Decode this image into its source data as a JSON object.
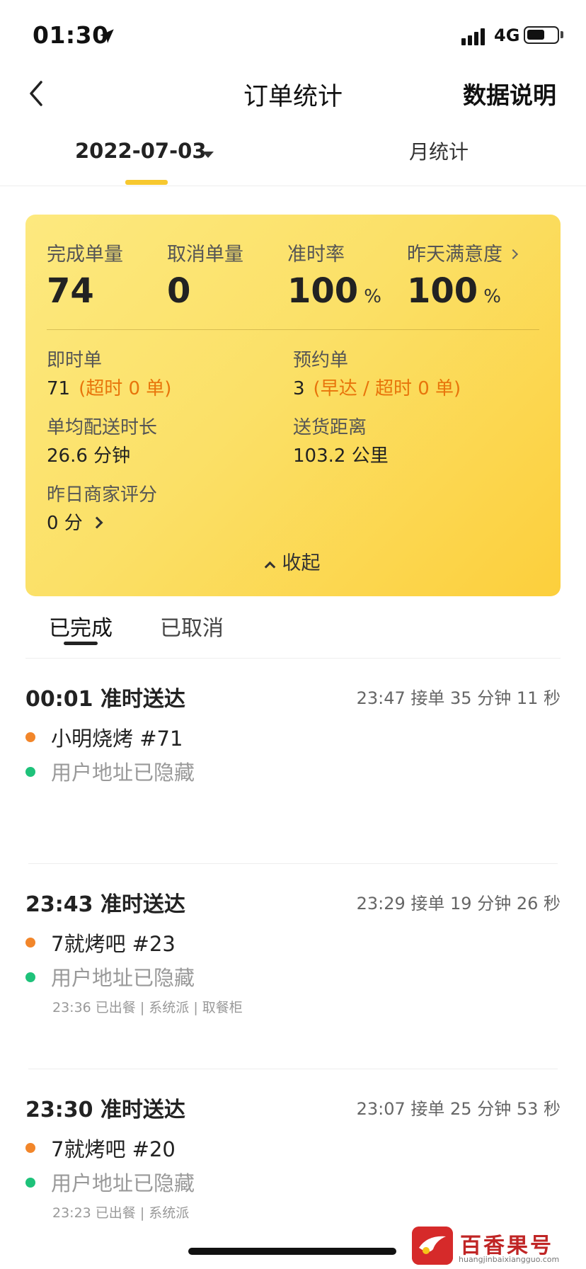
{
  "status_bar": {
    "time": "01:30",
    "network": "4G",
    "battery_level": 0.6
  },
  "nav": {
    "title": "订单统计",
    "right_action": "数据说明"
  },
  "date_tabs": {
    "date": "2022-07-03",
    "month_tab": "月统计"
  },
  "stats": {
    "completed_label": "完成单量",
    "completed_value": "74",
    "cancelled_label": "取消单量",
    "cancelled_value": "0",
    "ontime_label": "准时率",
    "ontime_value": "100",
    "ontime_unit": "%",
    "satisfaction_label": "昨天满意度",
    "satisfaction_value": "100",
    "satisfaction_unit": "%"
  },
  "details": {
    "instant_label": "即时单",
    "instant_value": "71",
    "instant_note": "(超时 0 单)",
    "reserved_label": "预约单",
    "reserved_value": "3",
    "reserved_note": "(早达 / 超时 0 单)",
    "avg_time_label": "单均配送时长",
    "avg_time_value": "26.6 分钟",
    "distance_label": "送货距离",
    "distance_value": "103.2 公里",
    "merchant_score_label": "昨日商家评分",
    "merchant_score_value": "0 分",
    "collapse_label": "收起"
  },
  "order_tabs": {
    "completed": "已完成",
    "cancelled": "已取消"
  },
  "orders": [
    {
      "title": "00:01 准时送达",
      "meta": "23:47 接单  35 分钟 11 秒",
      "shop": "小明烧烤  #71",
      "address": "用户地址已隐藏",
      "note": ""
    },
    {
      "title": "23:43 准时送达",
      "meta": "23:29 接单  19 分钟 26 秒",
      "shop": "7就烤吧  #23",
      "address": "用户地址已隐藏",
      "note": "23:36 已出餐 | 系统派 | 取餐柜"
    },
    {
      "title": "23:30 准时送达",
      "meta": "23:07 接单  25 分钟 53 秒",
      "shop": "7就烤吧  #20",
      "address": "用户地址已隐藏",
      "note": "23:23 已出餐 | 系统派"
    }
  ],
  "watermark": {
    "name": "百香果号",
    "url": "huangjinbaixiangguo.com"
  }
}
